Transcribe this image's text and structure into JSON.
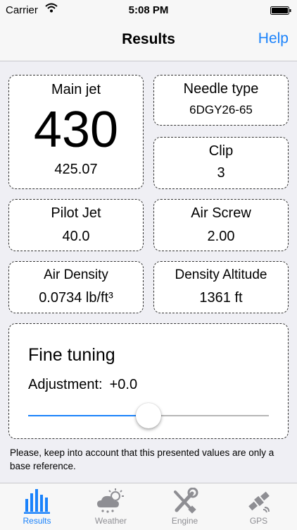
{
  "status_bar": {
    "carrier": "Carrier",
    "time": "5:08 PM",
    "icons": [
      "wifi-icon",
      "battery-icon"
    ]
  },
  "nav": {
    "title": "Results",
    "help_label": "Help"
  },
  "results": {
    "main_jet": {
      "label": "Main jet",
      "value": "430",
      "exact": "425.07"
    },
    "needle_type": {
      "label": "Needle type",
      "value": "6DGY26-65"
    },
    "clip": {
      "label": "Clip",
      "value": "3"
    },
    "pilot_jet": {
      "label": "Pilot Jet",
      "value": "40.0"
    },
    "air_screw": {
      "label": "Air Screw",
      "value": "2.00"
    },
    "air_density": {
      "label": "Air Density",
      "value": "0.0734 lb/ft³"
    },
    "density_altitude": {
      "label": "Density Altitude",
      "value": "1361 ft"
    }
  },
  "fine_tuning": {
    "title": "Fine tuning",
    "adjustment_label": "Adjustment:",
    "adjustment_value": "+0.0",
    "slider_fraction": 0.5
  },
  "note": "Please, keep into account that this presented values are only a base reference.",
  "tabs": [
    {
      "label": "Results",
      "icon": "bar-chart-icon",
      "active": true
    },
    {
      "label": "Weather",
      "icon": "weather-cloud-icon",
      "active": false
    },
    {
      "label": "Engine",
      "icon": "wrench-screwdriver-icon",
      "active": false
    },
    {
      "label": "GPS",
      "icon": "satellite-icon",
      "active": false
    }
  ],
  "colors": {
    "accent": "#1a82fb",
    "tab_inactive": "#8e8e93",
    "background": "#efeff4"
  }
}
